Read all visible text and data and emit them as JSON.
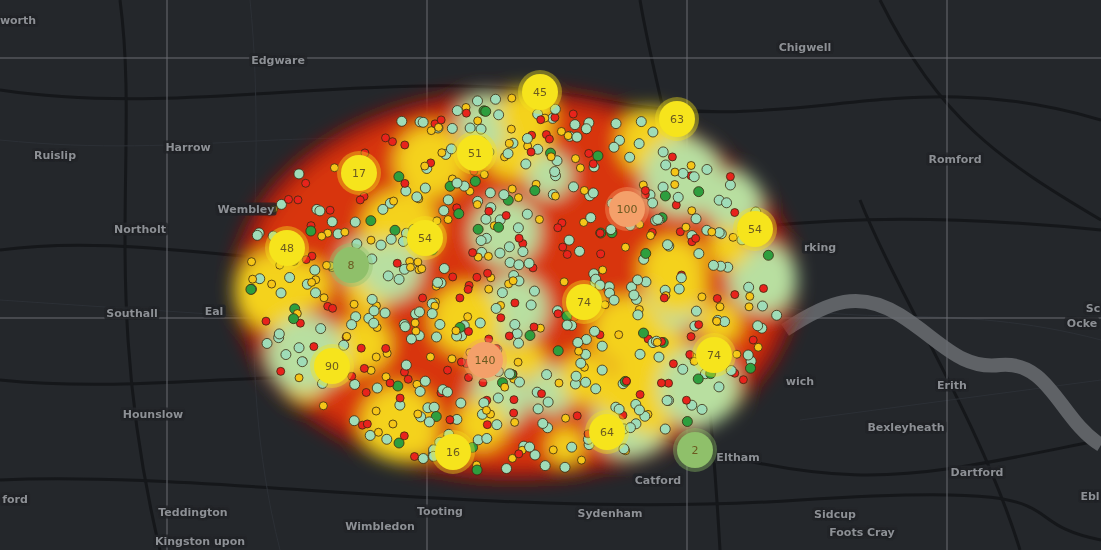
{
  "place_labels": [
    {
      "text": "worth"
    },
    {
      "text": "Edgware"
    },
    {
      "text": "Chigwell"
    },
    {
      "text": "Ruislip"
    },
    {
      "text": "Harrow"
    },
    {
      "text": "Romford"
    },
    {
      "text": "Wembley"
    },
    {
      "text": "Northolt"
    },
    {
      "text": "Southall"
    },
    {
      "text": "Eal"
    },
    {
      "text": "rking"
    },
    {
      "text": "Sc"
    },
    {
      "text": "Ocke"
    },
    {
      "text": "wich"
    },
    {
      "text": "Erith"
    },
    {
      "text": "Hounslow"
    },
    {
      "text": "Bexleyheath"
    },
    {
      "text": "Eltham"
    },
    {
      "text": "Catford"
    },
    {
      "text": "Dartford"
    },
    {
      "text": "ford"
    },
    {
      "text": "Ebl"
    },
    {
      "text": "Teddington"
    },
    {
      "text": "Tooting"
    },
    {
      "text": "Sydenham"
    },
    {
      "text": "Wimbledon"
    },
    {
      "text": "Sidcup"
    },
    {
      "text": "Foots Cray"
    },
    {
      "text": "Kingston upon"
    }
  ],
  "clusters": [
    {
      "count": "45",
      "color": "#f6e41c"
    },
    {
      "count": "63",
      "color": "#f6e41c"
    },
    {
      "count": "17",
      "color": "#f6e41c"
    },
    {
      "count": "51",
      "color": "#f6e41c"
    },
    {
      "count": "100",
      "color": "#f4a06a"
    },
    {
      "count": "54",
      "color": "#f6e41c"
    },
    {
      "count": "48",
      "color": "#f6e41c"
    },
    {
      "count": "8",
      "color": "#8fc06a"
    },
    {
      "count": "54",
      "color": "#f6e41c"
    },
    {
      "count": "74",
      "color": "#f6e41c"
    },
    {
      "count": "140",
      "color": "#f4a06a"
    },
    {
      "count": "90",
      "color": "#f6e41c"
    },
    {
      "count": "74",
      "color": "#f6e41c"
    },
    {
      "count": "64",
      "color": "#f6e41c"
    },
    {
      "count": "16",
      "color": "#f6e41c"
    },
    {
      "count": "2",
      "color": "#8fc06a"
    }
  ]
}
